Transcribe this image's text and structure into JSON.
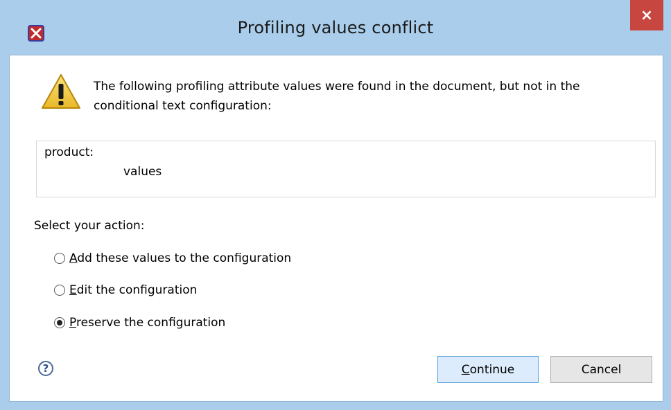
{
  "dialog": {
    "title": "Profiling values conflict",
    "close_symbol": "×",
    "app_icon": "oxygen-x-icon",
    "message_line1": "The following profiling attribute values were found in the document, but not in the",
    "message_line2": "conditional text configuration:",
    "warning_icon": "warning-icon",
    "conflicts": {
      "attribute": "product:",
      "value": "values"
    },
    "action_label": "Select your action:",
    "options": [
      {
        "mnemonic": "A",
        "rest": "dd these values to the configuration",
        "selected": false
      },
      {
        "mnemonic": "E",
        "rest": "dit the configuration",
        "selected": false
      },
      {
        "mnemonic": "P",
        "rest": "reserve the configuration",
        "selected": true
      }
    ],
    "help_symbol": "?",
    "continue_mnemonic": "C",
    "continue_rest": "ontinue",
    "cancel_label": "Cancel"
  },
  "colors": {
    "titlebar": "#a9cdea",
    "close_button": "#c7463f",
    "default_button": "#dcecfc"
  }
}
